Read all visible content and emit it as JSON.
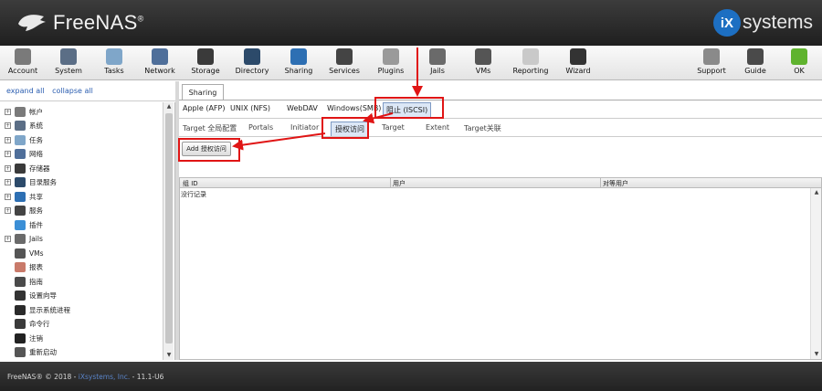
{
  "header": {
    "brand": "FreeNAS",
    "trademark": "®",
    "partner_badge": "iX",
    "partner_text": "systems"
  },
  "toolbar": {
    "items": [
      {
        "label": "Account",
        "icon": "account-icon",
        "color": "#7a7a7a"
      },
      {
        "label": "System",
        "icon": "system-icon",
        "color": "#5b6e86"
      },
      {
        "label": "Tasks",
        "icon": "tasks-icon",
        "color": "#7fa6c9"
      },
      {
        "label": "Network",
        "icon": "network-icon",
        "color": "#4f6f9a"
      },
      {
        "label": "Storage",
        "icon": "storage-icon",
        "color": "#3a3a3a"
      },
      {
        "label": "Directory",
        "icon": "directory-icon",
        "color": "#2c4a6a"
      },
      {
        "label": "Sharing",
        "icon": "sharing-icon",
        "color": "#2d6fb3"
      },
      {
        "label": "Services",
        "icon": "services-icon",
        "color": "#444444"
      },
      {
        "label": "Plugins",
        "icon": "plugins-icon",
        "color": "#9a9a9a"
      },
      {
        "label": "Jails",
        "icon": "jails-icon",
        "color": "#6a6a6a"
      },
      {
        "label": "VMs",
        "icon": "vms-icon",
        "color": "#555555"
      },
      {
        "label": "Reporting",
        "icon": "reporting-icon",
        "color": "#c9c9c9"
      },
      {
        "label": "Wizard",
        "icon": "wizard-icon",
        "color": "#333333"
      },
      {
        "label": "Support",
        "icon": "support-icon",
        "color": "#8a8a8a"
      },
      {
        "label": "Guide",
        "icon": "guide-icon",
        "color": "#4a4a4a"
      },
      {
        "label": "OK",
        "icon": "alert-ok-icon",
        "color": "#5fb32e"
      }
    ]
  },
  "sidebar": {
    "expand_all": "expand all",
    "collapse_all": "collapse all",
    "items": [
      {
        "label": "帐户",
        "expandable": true,
        "icon": "account-icon",
        "color": "#7a7a7a"
      },
      {
        "label": "系统",
        "expandable": true,
        "icon": "system-icon",
        "color": "#5b6e86"
      },
      {
        "label": "任务",
        "expandable": true,
        "icon": "tasks-icon",
        "color": "#7fa6c9"
      },
      {
        "label": "网络",
        "expandable": true,
        "icon": "network-icon",
        "color": "#4f6f9a"
      },
      {
        "label": "存储器",
        "expandable": true,
        "icon": "storage-icon",
        "color": "#3a3a3a"
      },
      {
        "label": "目录服务",
        "expandable": true,
        "icon": "directory-icon",
        "color": "#2c4a6a"
      },
      {
        "label": "共享",
        "expandable": true,
        "icon": "sharing-icon",
        "color": "#2d6fb3"
      },
      {
        "label": "服务",
        "expandable": true,
        "icon": "services-icon",
        "color": "#444444"
      },
      {
        "label": "插件",
        "expandable": false,
        "icon": "plugins-icon",
        "color": "#3b8fd6"
      },
      {
        "label": "Jails",
        "expandable": true,
        "icon": "jails-icon",
        "color": "#6a6a6a"
      },
      {
        "label": "VMs",
        "expandable": false,
        "icon": "vms-icon",
        "color": "#555555"
      },
      {
        "label": "报表",
        "expandable": false,
        "icon": "reporting-icon",
        "color": "#c97a6a"
      },
      {
        "label": "指南",
        "expandable": false,
        "icon": "guide-icon",
        "color": "#4a4a4a"
      },
      {
        "label": "设置向导",
        "expandable": false,
        "icon": "wizard-icon",
        "color": "#333333"
      },
      {
        "label": "显示系统进程",
        "expandable": false,
        "icon": "processes-icon",
        "color": "#2a2a2a"
      },
      {
        "label": "命令行",
        "expandable": false,
        "icon": "shell-icon",
        "color": "#3a3a3a"
      },
      {
        "label": "注销",
        "expandable": false,
        "icon": "logout-icon",
        "color": "#222222"
      },
      {
        "label": "重新启动",
        "expandable": false,
        "icon": "reboot-icon",
        "color": "#555555"
      }
    ]
  },
  "main": {
    "tab": "Sharing",
    "share_tabs": [
      "Apple (AFP)",
      "UNIX (NFS)",
      "WebDAV",
      "Windows(SMB)",
      "阻止 (ISCSI)"
    ],
    "iscsi_tabs": [
      "Target 全局配置",
      "Portals",
      "Initiator",
      "授权访问",
      "Target",
      "Extent",
      "Target关联"
    ],
    "add_button": "Add 授权访问",
    "columns": [
      "组 ID",
      "用户",
      "对等用户"
    ],
    "no_records": "没行记录"
  },
  "footer": {
    "copyright": "FreeNAS® © 2018 - ",
    "company_link": "iXsystems, Inc.",
    "version": " - 11.1-U6"
  },
  "annotation_color": "#e01515"
}
